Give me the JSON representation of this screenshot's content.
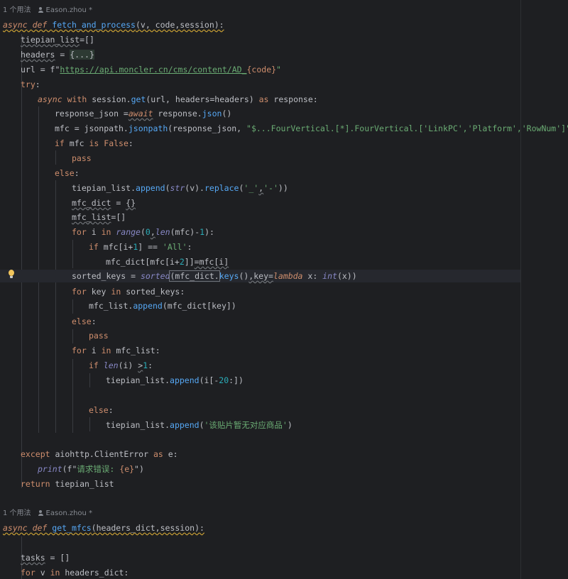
{
  "inlay_hints": [
    {
      "usages": "1 个用法",
      "author": "Eason.zhou *"
    },
    {
      "usages": "1 个用法",
      "author": "Eason.zhou *"
    }
  ],
  "code": {
    "l1_kw1": "async",
    "l1_kw2": "def",
    "l1_fn": "fetch_and_process",
    "l1_rest": "(v, code,session):",
    "l2_a": "tiepian_list",
    "l2_b": "=[]",
    "l3_a": "headers",
    "l3_b": " = ",
    "l3_c": "{...}",
    "l4_a": "url = f\"",
    "l4_url": "https://api.moncler.cn/cms/content/AD_",
    "l4_b": "{code}",
    "l4_c": "\"",
    "l5_kw": "try",
    "l6_kw1": "async",
    "l6_kw2": "with",
    "l6_a": " session.",
    "l6_fn": "get",
    "l6_b": "(url, headers=headers) ",
    "l6_kw3": "as",
    "l6_c": " response:",
    "l7_a": "response_json =",
    "l7_kw": "await",
    "l7_b": " response.",
    "l7_fn": "json",
    "l7_c": "()",
    "l8_a": "mfc = jsonpath.",
    "l8_fn": "jsonpath",
    "l8_b": "(response_json, ",
    "l8_str": "\"$...FourVertical.[*].FourVertical.['LinkPC','Platform','RowNum']\"",
    "l8_c": ")",
    "l9_kw1": "if",
    "l9_a": " mfc ",
    "l9_kw2": "is",
    "l9_kw3": "False",
    "l10_kw": "pass",
    "l11_kw": "else",
    "l12_a": "tiepian_list.",
    "l12_fn": "append",
    "l12_b": "(",
    "l12_bi": "str",
    "l12_c": "(v).",
    "l12_fn2": "replace",
    "l12_d": "(",
    "l12_s1": "'_'",
    "l12_e": ",",
    "l12_s2": "'-'",
    "l12_f": "))",
    "l13_a": "mfc_dict",
    "l13_b": " = ",
    "l13_c": "{}",
    "l14_a": "mfc_list",
    "l14_b": "=[]",
    "l15_kw1": "for",
    "l15_a": " i ",
    "l15_kw2": "in",
    "l15_bi": "range",
    "l15_b": "(",
    "l15_n0": "0",
    "l15_c": ",",
    "l15_bi2": "len",
    "l15_d": "(mfc)-",
    "l15_n1": "1",
    "l15_e": "):",
    "l16_kw": "if",
    "l16_a": " mfc[i+",
    "l16_n1": "1",
    "l16_b": "] == ",
    "l16_str": "'All'",
    "l16_c": ":",
    "l17_a": "mfc_dict[mfc[i+",
    "l17_n": "2",
    "l17_b": "]]",
    "l17_c": "=mfc[i]",
    "l18_a": "sorted_keys = ",
    "l18_bi": "sorted",
    "l18_b": "(mfc_dict.",
    "l18_fn": "keys",
    "l18_c": "()",
    "l18_d": ",key=",
    "l18_kw": "lambda",
    "l18_e": " x: ",
    "l18_bi2": "int",
    "l18_f": "(x))",
    "l19_kw1": "for",
    "l19_a": " key ",
    "l19_kw2": "in",
    "l19_b": " sorted_keys:",
    "l20_a": "mfc_list.",
    "l20_fn": "append",
    "l20_b": "(mfc_dict[key])",
    "l21_kw": "else",
    "l22_kw": "pass",
    "l23_kw1": "for",
    "l23_a": " i ",
    "l23_kw2": "in",
    "l23_b": " mfc_list:",
    "l24_kw": "if",
    "l24_bi": "len",
    "l24_a": "(i) ",
    "l24_b": ">",
    "l24_n": "1",
    "l25_a": "tiepian_list.",
    "l25_fn": "append",
    "l25_b": "(i[-",
    "l25_n": "20",
    "l25_c": ":])",
    "l26_kw": "else",
    "l27_a": "tiepian_list.",
    "l27_fn": "append",
    "l27_b": "(",
    "l27_str": "'该贴片暂无对应商品'",
    "l27_c": ")",
    "l28_kw1": "except",
    "l28_a": " aiohttp.ClientError ",
    "l28_kw2": "as",
    "l28_b": " e:",
    "l29_bi": "print",
    "l29_a": "(f\"",
    "l29_str": "请求错误: ",
    "l29_b": "{e}",
    "l29_c": "\")",
    "l30_kw": "return",
    "l30_a": " tiepian_list",
    "l31_kw1": "async",
    "l31_kw2": "def",
    "l31_fn": "get_mfcs",
    "l31_rest": "(headers_dict,session):",
    "l32_a": "tasks",
    "l32_b": " = []",
    "l33_kw1": "for",
    "l33_a": " v ",
    "l33_kw2": "in",
    "l33_b": " headers_dict:"
  },
  "colors": {
    "background": "#1e1f22",
    "keyword": "#cf8e6d",
    "function": "#56a8f5",
    "string": "#6aab73",
    "number": "#2aacb8",
    "builtin": "#8888c6"
  },
  "icons": [
    "user-icon",
    "lightbulb-icon"
  ]
}
